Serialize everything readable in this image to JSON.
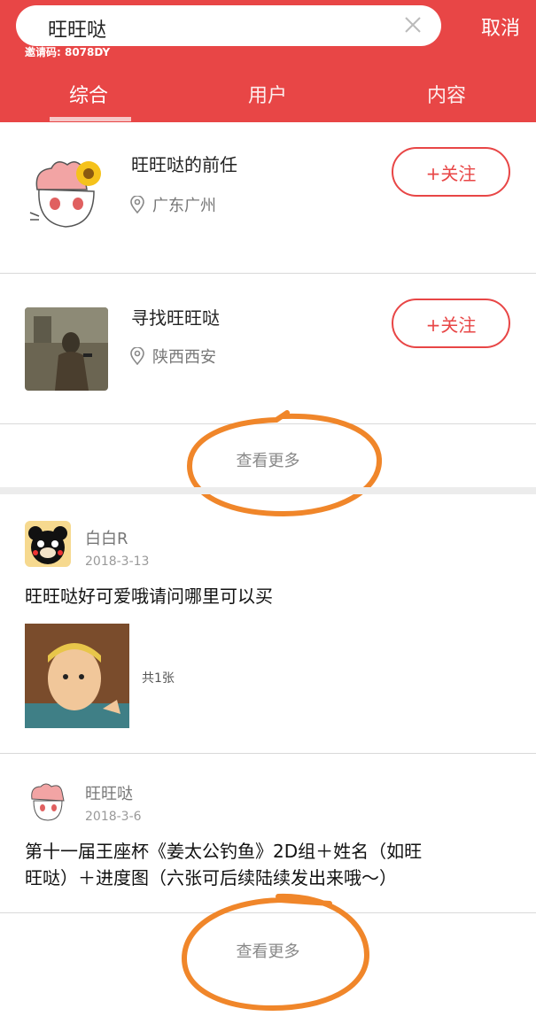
{
  "search": {
    "query": "旺旺哒",
    "cancel_label": "取消",
    "watermark": "邀请码: 8078DY"
  },
  "tabs": [
    {
      "label": "综合"
    },
    {
      "label": "用户"
    },
    {
      "label": "内容"
    }
  ],
  "users": [
    {
      "name": "旺旺哒的前任",
      "location": "广东广州",
      "follow_label": "+关注",
      "avatar": "mascot-avatar"
    },
    {
      "name": "寻找旺旺哒",
      "location": "陕西西安",
      "follow_label": "+关注",
      "avatar": "game-character-avatar"
    }
  ],
  "more_users_label": "查看更多",
  "posts": [
    {
      "author": "白白R",
      "date": "2018-3-13",
      "text": "旺旺哒好可爱哦请问哪里可以买",
      "image_count": "共1张"
    },
    {
      "author": "旺旺哒",
      "date": "2018-3-6",
      "text_line1": "第十一届王座杯《姜太公钓鱼》2D组＋姓名（如旺",
      "text_line2": "旺哒）＋进度图（六张可后续陆续发出来哦～）"
    }
  ],
  "more_posts_label": "查看更多",
  "colors": {
    "brand": "#e84646",
    "annotation": "#f0862a"
  }
}
